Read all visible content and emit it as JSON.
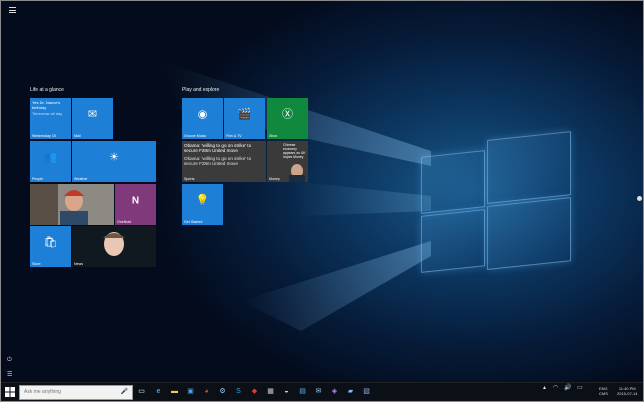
{
  "start_menu": {
    "groups": [
      {
        "title": "Life at a glance"
      },
      {
        "title": "Play and explore"
      }
    ],
    "tiles": {
      "calendar_event": "Yes Dr. Nance's birthday",
      "calendar_sub": "Tomorrow all day",
      "calendar_day": "Wednesday 15",
      "mail": "Mail",
      "people": "People",
      "weather": "Weather",
      "onenote": "OneNote",
      "store": "Store",
      "news": "News",
      "groove": "Groove Music",
      "films": "Film & TV",
      "xbox": "Xbox",
      "sports_headline": "Obama: 'willing to go on strike' to secure F28m United move",
      "sports": "Sports",
      "money_headline": "Chinese economy appears on UK hopes Money",
      "money": "Money",
      "get_started": "Get Started"
    }
  },
  "taskbar": {
    "search_placeholder": "Ask me anything",
    "tray": {
      "lang_line1": "ENG",
      "lang_line2": "CMS",
      "time": "11:40 PM",
      "date": "2015-07-14"
    }
  },
  "colors": {
    "tile_blue": "#1e7fd6",
    "xbox_green": "#10893e",
    "onenote_purple": "#80397b",
    "taskbar": "#0b0f16"
  }
}
